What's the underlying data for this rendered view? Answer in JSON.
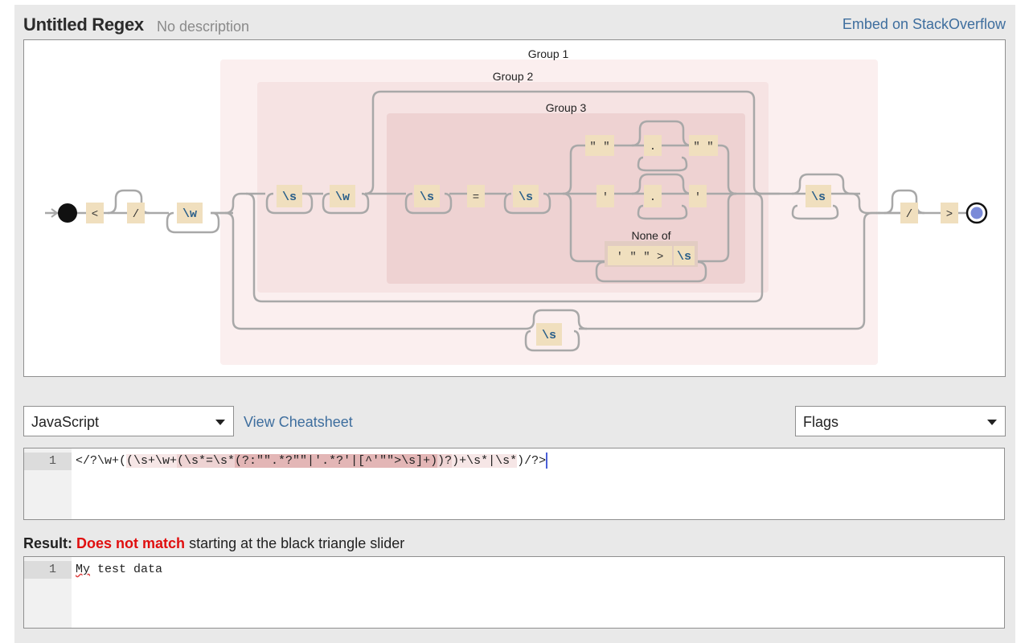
{
  "header": {
    "title": "Untitled Regex",
    "description": "No description",
    "embed_link": "Embed on StackOverflow"
  },
  "diagram": {
    "group_labels": [
      "Group 1",
      "Group 2",
      "Group 3"
    ],
    "none_of_label": "None of",
    "tokens": {
      "lt": "<",
      "slash": "/",
      "gt": ">",
      "word": "\\w",
      "space": "\\s",
      "equals": "=",
      "dquote": "\" \"",
      "squote": "'",
      "any": ".",
      "none_of_set": "' \" \" >",
      "none_of_space": "\\s"
    },
    "colors": {
      "group1": "#fbefef",
      "group2": "#f6e3e3",
      "group3": "#eed2d2",
      "literal": "#f0dfbe",
      "none_of": "#e2ccc2",
      "rail": "#a8a8a8",
      "end_dot": "#7b8bd8"
    }
  },
  "flavor_select": {
    "value": "JavaScript"
  },
  "cheatsheet_link": "View Cheatsheet",
  "flags_select": {
    "value": "Flags"
  },
  "regex_editor": {
    "line_number": "1",
    "segments": {
      "s0": "</?\\w+(",
      "s1": "(\\s+\\w+",
      "s2": "(\\s*=\\s*",
      "s3": "(?:\"\".*?\"\"|'.*?'|[^'\"\">\\s]+)",
      "s4": ")?",
      "s5": ")+\\s*|\\s*",
      "s6": ")/?>"
    }
  },
  "result": {
    "label": "Result:",
    "status": "Does not match",
    "detail": "starting at the black triangle slider"
  },
  "test_editor": {
    "line_number": "1",
    "first_word": "My",
    "rest": " test data"
  }
}
